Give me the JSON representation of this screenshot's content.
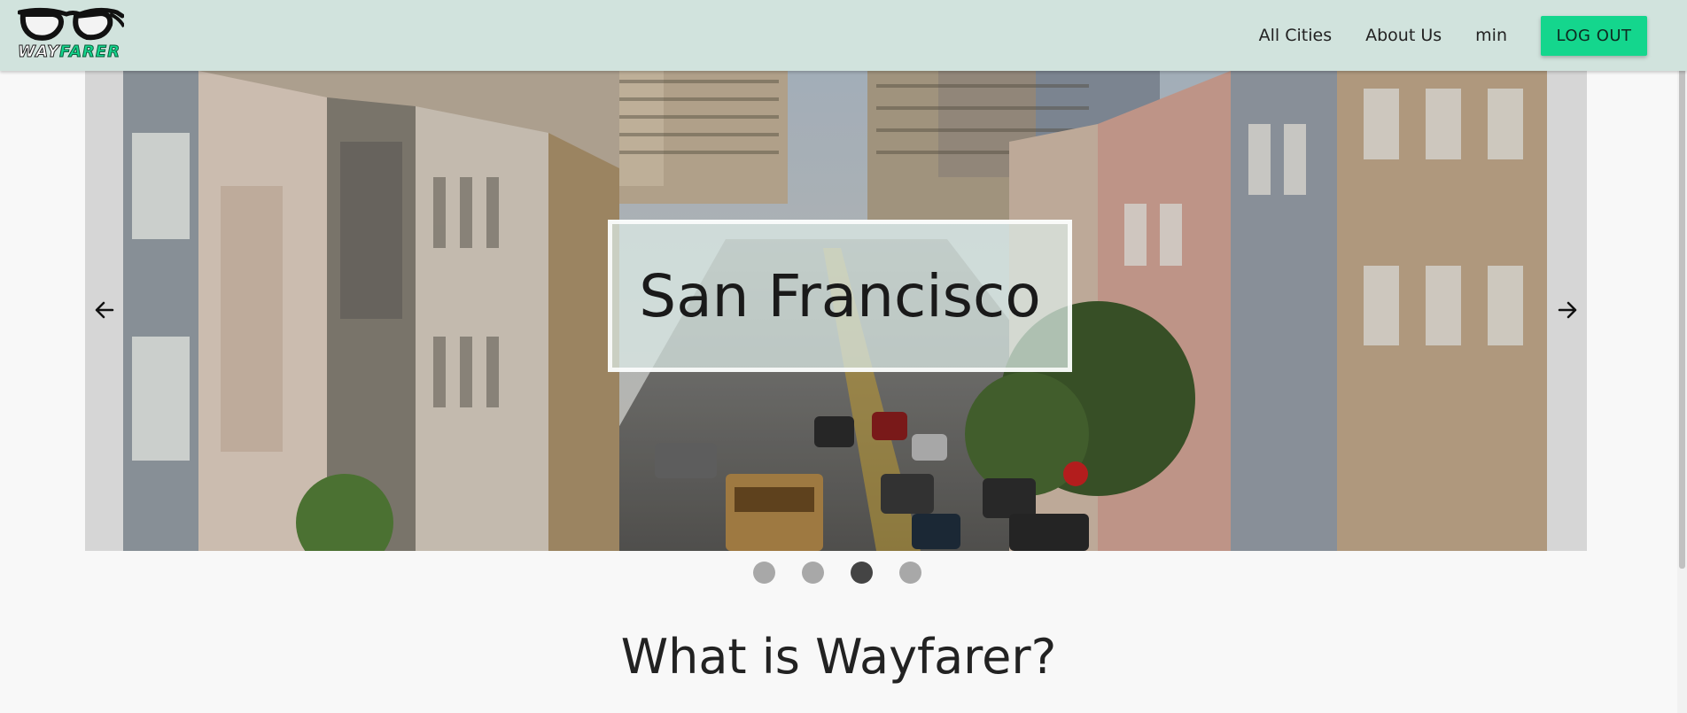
{
  "brand": {
    "logo_word_part1": "WAY",
    "logo_word_part2": "FARER",
    "logo_icon": "glasses-icon",
    "accent_color": "#14d68d",
    "navbar_color": "#d1e3dd"
  },
  "nav": {
    "links": [
      "All Cities",
      "About Us",
      "min"
    ],
    "logout_label": "LOG OUT"
  },
  "carousel": {
    "caption": "San Francisco",
    "prev_icon": "arrow-left-icon",
    "next_icon": "arrow-right-icon",
    "slide_count": 4,
    "active_index": 2
  },
  "main": {
    "section_title": "What is Wayfarer?"
  }
}
